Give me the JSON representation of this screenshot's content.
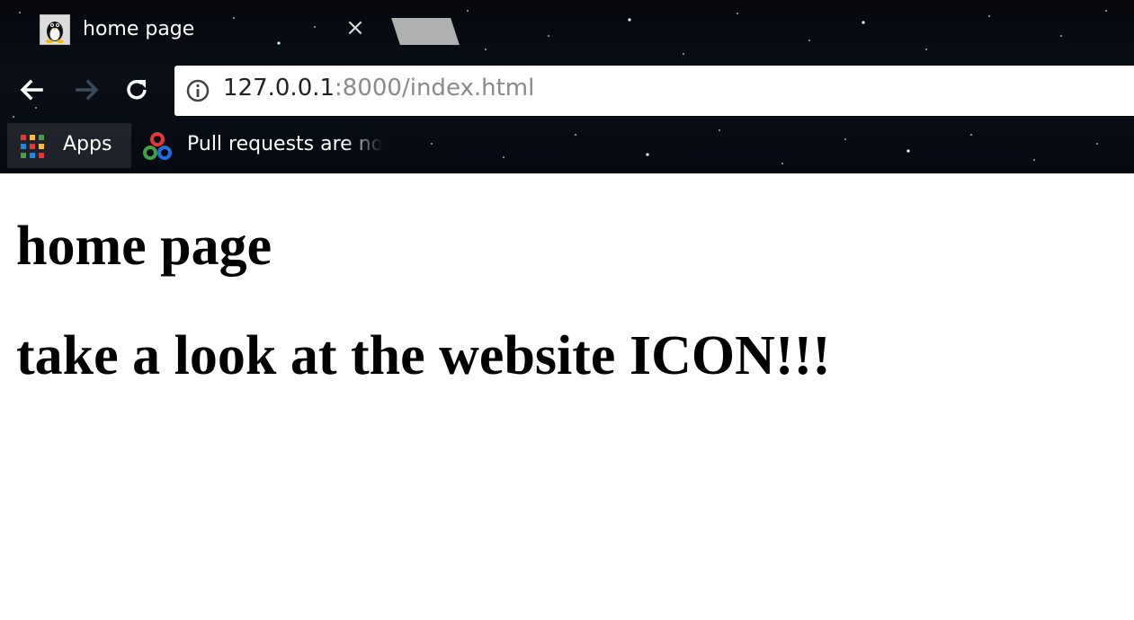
{
  "tab": {
    "title": "home page",
    "close_glyph": "×",
    "favicon_icon": "linux-penguin-icon"
  },
  "toolbar": {
    "back_icon": "arrow-left-icon",
    "forward_icon": "arrow-right-icon",
    "reload_icon": "reload-icon",
    "info_icon": "info-icon",
    "url_host": "127.0.0.1",
    "url_rest": ":8000/index.html"
  },
  "bookmarks": [
    {
      "label": "Apps",
      "icon": "apps-grid-icon"
    },
    {
      "label": "Pull requests are no",
      "icon": "opencv-logo-icon"
    }
  ],
  "page": {
    "heading1": "home page",
    "heading2": "take a look at the website ICON!!!"
  },
  "colors": {
    "chrome_background": "#060910",
    "page_background": "#ffffff",
    "url_host": "#222222",
    "url_rest": "#8a8a8a"
  }
}
